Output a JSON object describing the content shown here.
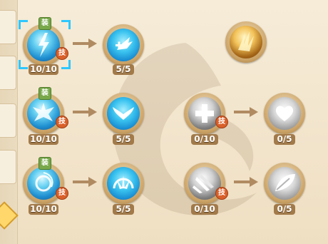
{
  "badges": {
    "equip": "装",
    "skill": "技"
  },
  "colors": {
    "label_bg": "#a27a4a",
    "accent_blue": "#2ec7ff",
    "arrow": "#b08b62"
  },
  "rows": [
    {
      "first": {
        "level": "10/10",
        "icon": "blue-lightning-orb-icon"
      },
      "second": {
        "level": "5/5",
        "icon": "heal-plus-arrow-icon"
      },
      "extra": {
        "icon": "golden-claw-locked-icon"
      }
    },
    {
      "first": {
        "level": "10/10",
        "icon": "blue-phoenix-icon"
      },
      "second": {
        "level": "5/5",
        "icon": "wings-icon"
      },
      "third": {
        "level": "0/10",
        "icon": "gray-cross-orb-icon"
      },
      "fourth": {
        "level": "0/5",
        "icon": "gray-heart-icon"
      }
    },
    {
      "first": {
        "level": "10/10",
        "icon": "blue-vortex-orb-icon"
      },
      "second": {
        "level": "5/5",
        "icon": "burst-icon"
      },
      "third": {
        "level": "0/10",
        "icon": "gray-claw-icon"
      },
      "fourth": {
        "level": "0/5",
        "icon": "gray-leaf-icon"
      }
    }
  ]
}
